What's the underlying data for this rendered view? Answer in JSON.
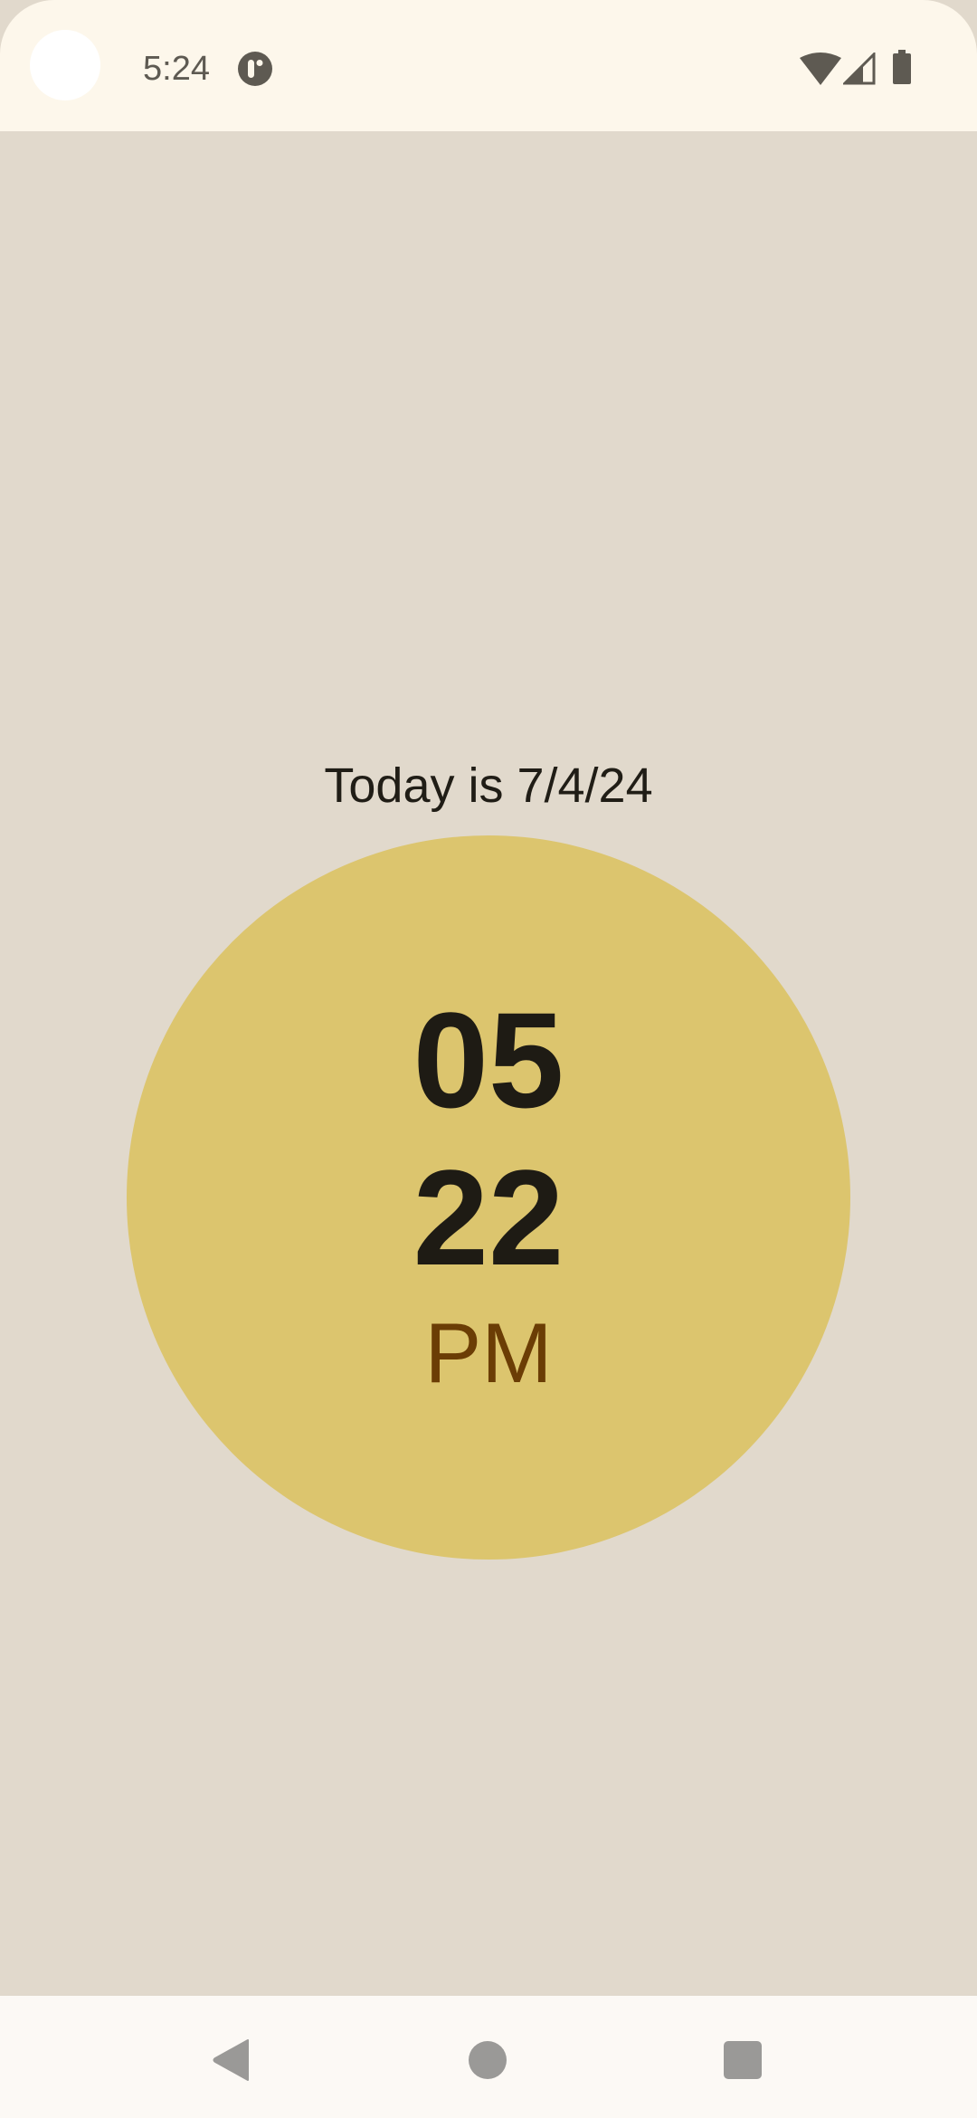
{
  "status_bar": {
    "time": "5:24",
    "notification_icon": "app-notification-icon",
    "icons": [
      "wifi-icon",
      "cellular-signal-icon",
      "battery-icon"
    ]
  },
  "clock": {
    "date_text": "Today is 7/4/24",
    "hours": "05",
    "minutes": "22",
    "ampm": "PM"
  },
  "colors": {
    "background": "#e1d9cc",
    "circle": "#dcc56e",
    "digits": "#1e1b14",
    "ampm": "#6b3d05",
    "status_bar": "#fdf7eb"
  },
  "nav_bar": {
    "buttons": [
      "back-icon",
      "home-icon",
      "recents-icon"
    ]
  }
}
